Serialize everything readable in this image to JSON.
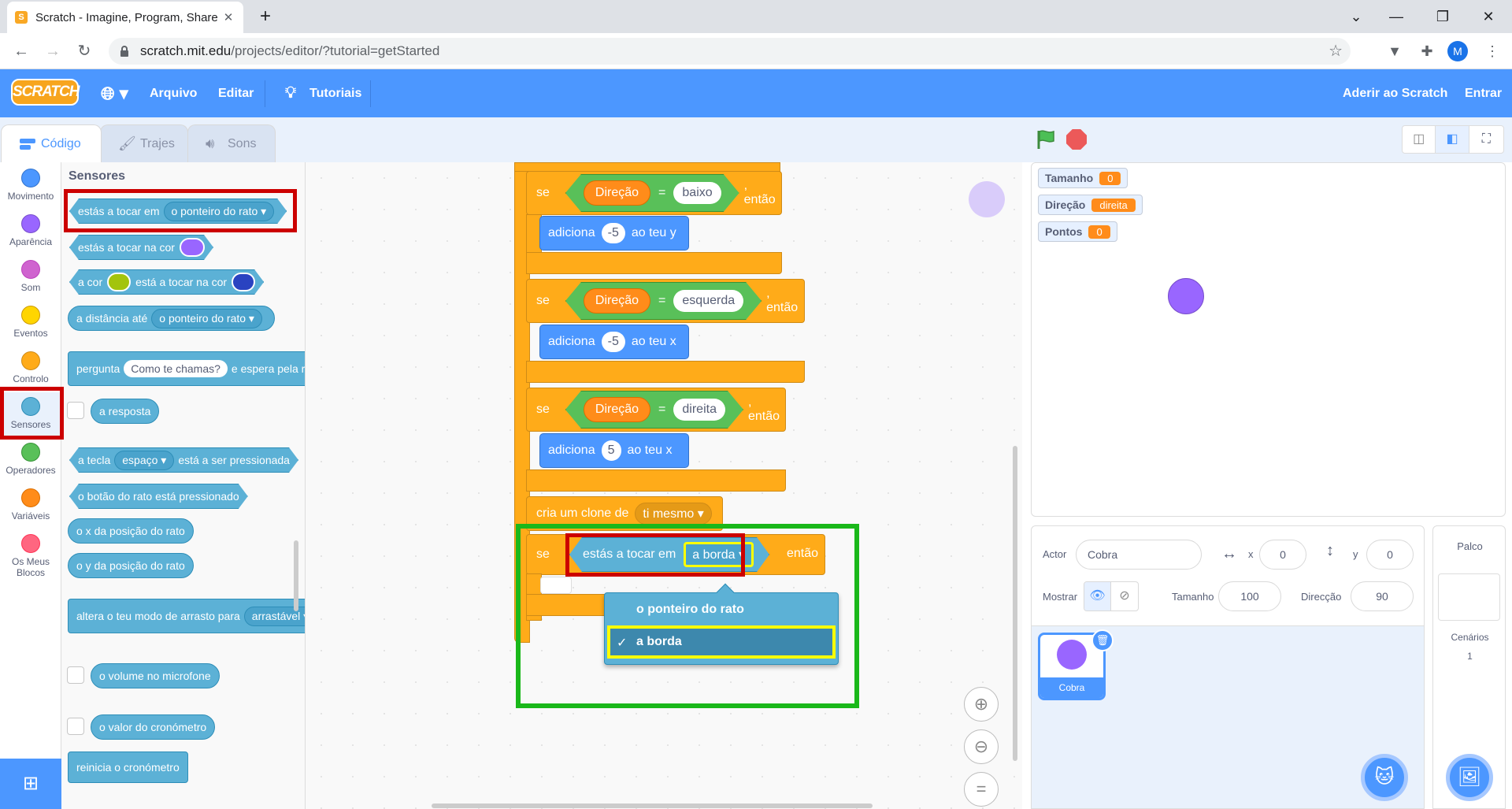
{
  "browser": {
    "tab_title": "Scratch - Imagine, Program, Share",
    "url_host": "scratch.mit.edu",
    "url_path": "/projects/editor/?tutorial=getStarted",
    "profile_initial": "M"
  },
  "menu": {
    "logo": "SCRATCH",
    "file": "Arquivo",
    "edit": "Editar",
    "tutorials": "Tutoriais",
    "join": "Aderir ao Scratch",
    "signin": "Entrar"
  },
  "tabs": {
    "code": "Código",
    "costumes": "Trajes",
    "sounds": "Sons"
  },
  "categories": [
    {
      "label": "Movimento",
      "color": "#4c97ff"
    },
    {
      "label": "Aparência",
      "color": "#9966ff"
    },
    {
      "label": "Som",
      "color": "#cf63cf"
    },
    {
      "label": "Eventos",
      "color": "#ffd500"
    },
    {
      "label": "Controlo",
      "color": "#ffab19"
    },
    {
      "label": "Sensores",
      "color": "#5cb1d6"
    },
    {
      "label": "Operadores",
      "color": "#59c059"
    },
    {
      "label": "Variáveis",
      "color": "#ff8c1a"
    },
    {
      "label": "Os Meus Blocos",
      "color": "#ff6680"
    }
  ],
  "palette": {
    "heading": "Sensores",
    "touching": "estás a tocar em",
    "touching_opt": "o ponteiro do rato",
    "touching_color": "estás a tocar na cor",
    "color_a": "a cor",
    "color_touching": "está a tocar na cor",
    "distance": "a distância até",
    "distance_opt": "o ponteiro do rato",
    "ask": "pergunta",
    "ask_default": "Como te chamas?",
    "ask_wait": "e espera pela re",
    "answer": "a resposta",
    "key_a": "a tecla",
    "key_opt": "espaço",
    "key_pressed": "está a ser pressionada",
    "mouse_down": "o botão do rato está pressionado",
    "mouse_x": "o x da posição do rato",
    "mouse_y": "o y da posição do rato",
    "drag_mode": "altera o teu modo de arrasto para",
    "drag_opt": "arrastável",
    "loudness": "o volume no microfone",
    "timer": "o valor do cronómetro",
    "reset_timer": "reinicia o cronómetro"
  },
  "script": {
    "if": "se",
    "then": ", então",
    "then2": "então",
    "direction_var": "Direção",
    "eq": "=",
    "dir1": "baixo",
    "change_y": "adiciona",
    "val1": "-5",
    "to_y": "ao teu y",
    "dir2": "esquerda",
    "val2": "-5",
    "to_x": "ao teu x",
    "dir3": "direita",
    "val3": "5",
    "clone": "cria um clone de",
    "clone_opt": "ti mesmo",
    "touching": "estás a tocar em",
    "touching_opt": "a borda"
  },
  "dropdown": {
    "options": [
      "o ponteiro do rato",
      "a borda"
    ],
    "selected": "a borda",
    "check": "✓"
  },
  "monitors": [
    {
      "label": "Tamanho",
      "value": "0"
    },
    {
      "label": "Direção",
      "value": "direita"
    },
    {
      "label": "Pontos",
      "value": "0"
    }
  ],
  "sprite_info": {
    "actor_label": "Actor",
    "actor_name": "Cobra",
    "x_label": "x",
    "x": "0",
    "y_label": "y",
    "y": "0",
    "show_label": "Mostrar",
    "size_label": "Tamanho",
    "size": "100",
    "direction_label": "Direcção",
    "direction": "90"
  },
  "sprites": [
    {
      "name": "Cobra"
    }
  ],
  "stage_panel": {
    "title": "Palco",
    "backdrops_label": "Cenários",
    "backdrops_count": "1"
  },
  "colors": {
    "accent": "#4c97ff",
    "sensing": "#5cb1d6",
    "control": "#ffab19",
    "operator": "#59c059",
    "variable": "#ff8c1a",
    "highlight_red": "#cc0000",
    "highlight_green": "#1ab81a",
    "highlight_yellow": "#ffff00"
  }
}
